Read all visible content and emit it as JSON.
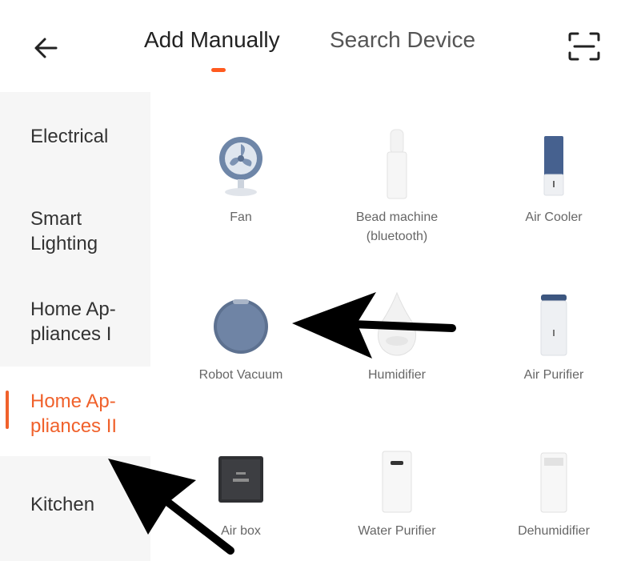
{
  "header": {
    "tabs": [
      {
        "label": "Add Manually",
        "active": true
      },
      {
        "label": "Search Device",
        "active": false
      }
    ],
    "accent_color": "#ff5a1f"
  },
  "sidebar": {
    "categories": [
      {
        "label": "Electrical",
        "active": false
      },
      {
        "label": "Smart\nLighting",
        "active": false
      },
      {
        "label": "Home Ap-\npliances I",
        "active": false
      },
      {
        "label": "Home Ap-\npliances II",
        "active": true
      },
      {
        "label": "Kitchen",
        "active": false
      }
    ],
    "active_color": "#f0612b"
  },
  "devices": [
    {
      "label": "Fan",
      "icon": "fan-icon"
    },
    {
      "label": "Bead machine\n(bluetooth)",
      "icon": "bead-machine-icon"
    },
    {
      "label": "Air Cooler",
      "icon": "air-cooler-icon"
    },
    {
      "label": "Robot Vacuum",
      "icon": "robot-vacuum-icon"
    },
    {
      "label": "Humidifier",
      "icon": "humidifier-icon"
    },
    {
      "label": "Air Purifier",
      "icon": "air-purifier-icon"
    },
    {
      "label": "Air box",
      "icon": "air-box-icon"
    },
    {
      "label": "Water Purifier",
      "icon": "water-purifier-icon"
    },
    {
      "label": "Dehumidifier",
      "icon": "dehumidifier-icon"
    }
  ]
}
